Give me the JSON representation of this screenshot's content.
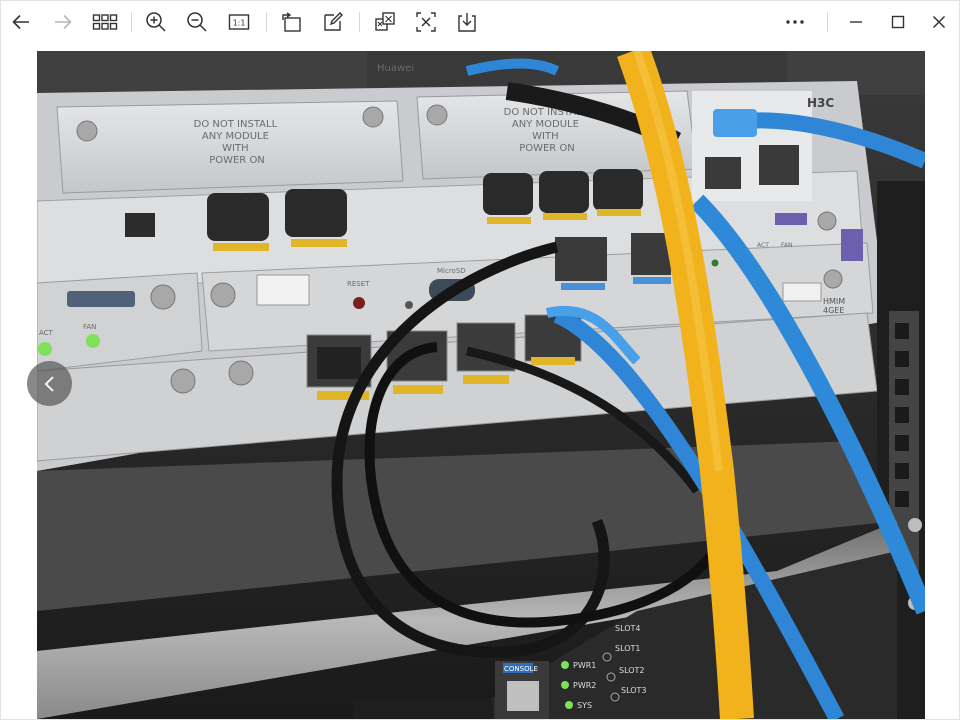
{
  "toolbar": {
    "left_buttons": [
      {
        "name": "back-button",
        "icon": "arrow-left-icon",
        "enabled": true
      },
      {
        "name": "forward-button",
        "icon": "arrow-right-icon",
        "enabled": false
      },
      {
        "name": "gallery-button",
        "icon": "grid-icon",
        "enabled": true
      },
      {
        "name": "zoom-in-button",
        "icon": "zoom-in-icon",
        "enabled": true
      },
      {
        "name": "zoom-out-button",
        "icon": "zoom-out-icon",
        "enabled": true
      },
      {
        "name": "actual-size-button",
        "icon": "actual-size-icon",
        "label": "1:1",
        "enabled": true
      },
      {
        "name": "rotate-button",
        "icon": "rotate-icon",
        "enabled": true
      },
      {
        "name": "edit-button",
        "icon": "edit-icon",
        "enabled": true
      },
      {
        "name": "compare-button",
        "icon": "compare-icon",
        "enabled": true
      },
      {
        "name": "formula-button",
        "icon": "formula-icon",
        "enabled": true
      },
      {
        "name": "save-button",
        "icon": "download-icon",
        "enabled": true
      }
    ],
    "actual_size_label": "1:1",
    "window_buttons": [
      {
        "name": "more-button",
        "icon": "more-icon"
      },
      {
        "name": "minimize-button",
        "icon": "minimize-icon"
      },
      {
        "name": "maximize-button",
        "icon": "maximize-icon"
      },
      {
        "name": "close-button",
        "icon": "close-icon"
      }
    ]
  },
  "viewer": {
    "prev_icon": "chevron-left-icon",
    "photo": {
      "subject": "network-equipment-rack-photo",
      "labels": {
        "module_top_left": [
          "DO NOT INSTALL",
          "ANY MODULE",
          "WITH",
          "POWER ON"
        ],
        "module_top_right": [
          "DO NOT INSTALL",
          "ANY MODULE",
          "WITH",
          "POWER ON"
        ],
        "brand": "H3C",
        "top_device": "Huawei",
        "reset": "RESET",
        "microsd": "MicroSD",
        "console": "CONSOLE",
        "pwr1": "PWR1",
        "pwr2": "PWR2",
        "sys": "SYS",
        "slot1": "SLOT1",
        "slot2": "SLOT2",
        "slot3": "SLOT3",
        "slot4": "SLOT4",
        "hmim": "HMIM",
        "hmim_sub": "4GEE",
        "act": "ACT",
        "fan": "FAN"
      }
    }
  }
}
